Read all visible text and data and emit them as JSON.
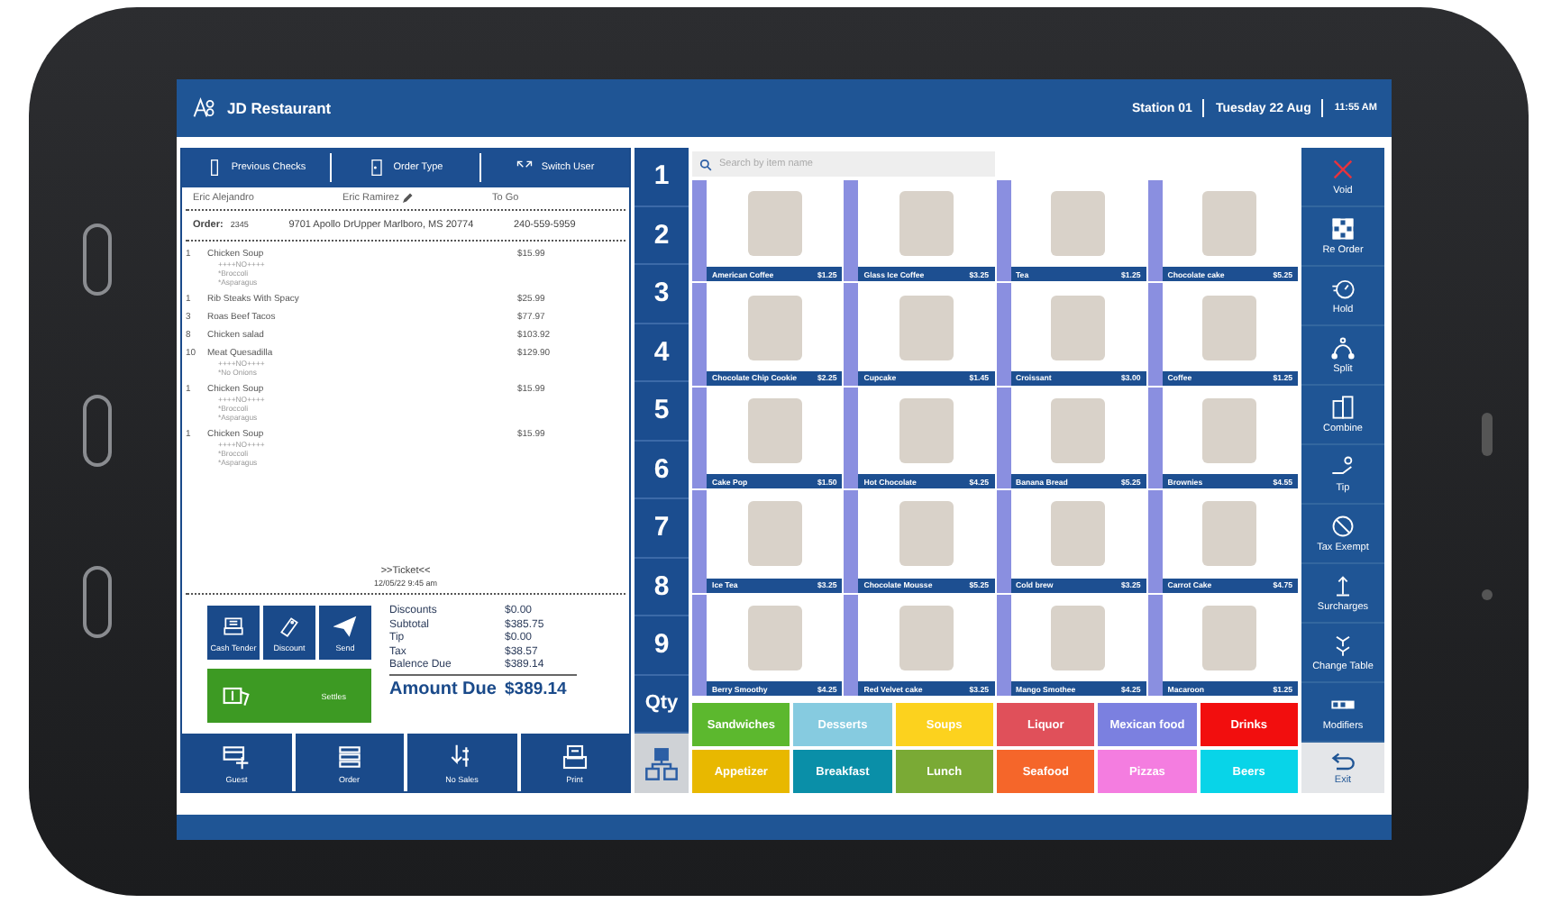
{
  "header": {
    "title": "JD Restaurant",
    "station": "Station 01",
    "date": "Tuesday 22 Aug",
    "time": "11:55 AM"
  },
  "ticket_toolbar": [
    "Previous Checks",
    "Order Type",
    "Switch User"
  ],
  "customer": {
    "guest": "Eric Alejandro",
    "server": "Eric Ramirez",
    "order_type": "To Go"
  },
  "order": {
    "label": "Order:",
    "number": "2345",
    "address": "9701 Apollo DrUpper Marlboro, MS 20774",
    "phone": "240-559-5959"
  },
  "items": [
    {
      "qty": "1",
      "name": "Chicken Soup",
      "price": "$15.99",
      "modifiers": [
        "++++NO++++",
        "*Broccoli",
        "*Asparagus"
      ]
    },
    {
      "qty": "1",
      "name": "Rib Steaks With Spacy",
      "price": "$25.99"
    },
    {
      "qty": "3",
      "name": "Roas Beef Tacos",
      "price": "$77.97"
    },
    {
      "qty": "8",
      "name": "Chicken salad",
      "price": "$103.92"
    },
    {
      "qty": "10",
      "name": "Meat Quesadilla",
      "price": "$129.90",
      "modifiers": [
        "++++NO++++",
        "*No Onions"
      ]
    },
    {
      "qty": "1",
      "name": "Chicken Soup",
      "price": "$15.99",
      "modifiers": [
        "++++NO++++",
        "*Broccoli",
        "*Asparagus"
      ]
    },
    {
      "qty": "1",
      "name": "Chicken Soup",
      "price": "$15.99",
      "modifiers": [
        "++++NO++++",
        "*Broccoli",
        "*Asparagus"
      ]
    }
  ],
  "ticket": {
    "title": ">>Ticket<<",
    "timestamp": "12/05/22 9:45 am"
  },
  "payment_actions": [
    "Cash Tender",
    "Discount",
    "Send"
  ],
  "settle": "Settles",
  "totals": [
    {
      "label": "Discounts",
      "value": "$0.00"
    },
    {
      "label": "Subtotal",
      "value": "$385.75"
    },
    {
      "label": "Tip",
      "value": "$0.00"
    },
    {
      "label": "Tax",
      "value": "$38.57"
    },
    {
      "label": "Balence Due",
      "value": "$389.14"
    }
  ],
  "amount_due": {
    "label": "Amount Due",
    "value": "$389.14"
  },
  "footer_buttons": [
    "Guest",
    "Order",
    "No Sales",
    "Print"
  ],
  "seats": [
    "1",
    "2",
    "3",
    "4",
    "5",
    "6",
    "7",
    "8",
    "9",
    "Qty"
  ],
  "search": {
    "placeholder": "Search by item name"
  },
  "products": [
    {
      "name": "American Coffee",
      "price": "$1.25"
    },
    {
      "name": "Glass Ice Coffee",
      "price": "$3.25"
    },
    {
      "name": "Tea",
      "price": "$1.25"
    },
    {
      "name": "Chocolate cake",
      "price": "$5.25"
    },
    {
      "name": "Chocolate Chip Cookie",
      "price": "$2.25"
    },
    {
      "name": "Cupcake",
      "price": "$1.45"
    },
    {
      "name": "Croissant",
      "price": "$3.00"
    },
    {
      "name": "Coffee",
      "price": "$1.25"
    },
    {
      "name": "Cake Pop",
      "price": "$1.50"
    },
    {
      "name": "Hot Chocolate",
      "price": "$4.25"
    },
    {
      "name": "Banana Bread",
      "price": "$5.25"
    },
    {
      "name": "Brownies",
      "price": "$4.55"
    },
    {
      "name": "Ice Tea",
      "price": "$3.25"
    },
    {
      "name": "Chocolate Mousse",
      "price": "$5.25"
    },
    {
      "name": "Cold brew",
      "price": "$3.25"
    },
    {
      "name": "Carrot Cake",
      "price": "$4.75"
    },
    {
      "name": "Berry Smoothy",
      "price": "$4.25"
    },
    {
      "name": "Red Velvet cake",
      "price": "$3.25"
    },
    {
      "name": "Mango Smothee",
      "price": "$4.25"
    },
    {
      "name": "Macaroon",
      "price": "$1.25"
    }
  ],
  "categories": [
    {
      "label": "Sandwiches",
      "color": "#5cb82e"
    },
    {
      "label": "Desserts",
      "color": "#86cbe0"
    },
    {
      "label": "Soups",
      "color": "#fcd21e"
    },
    {
      "label": "Liquor",
      "color": "#e0505a"
    },
    {
      "label": "Mexican food",
      "color": "#7b80e0"
    },
    {
      "label": "Drinks",
      "color": "#f20e0e"
    },
    {
      "label": "Appetizer",
      "color": "#e8b800"
    },
    {
      "label": "Breakfast",
      "color": "#0a8fa8"
    },
    {
      "label": "Lunch",
      "color": "#7aaa35"
    },
    {
      "label": "Seafood",
      "color": "#f5662a"
    },
    {
      "label": "Pizzas",
      "color": "#f47de0"
    },
    {
      "label": "Beers",
      "color": "#08d4e8"
    }
  ],
  "sidebar_actions": [
    "Void",
    "Re Order",
    "Hold",
    "Split",
    "Combine",
    "Tip",
    "Tax Exempt",
    "Surcharges",
    "Change Table",
    "Modifiers"
  ],
  "exit": "Exit"
}
